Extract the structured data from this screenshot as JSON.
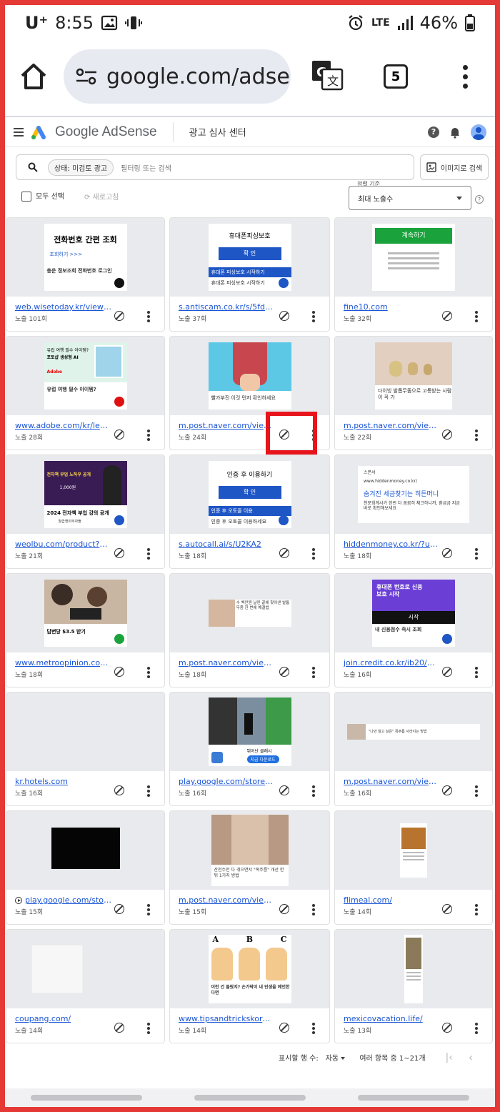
{
  "status": {
    "carrier": "U⁺",
    "time": "8:55",
    "network": "LTE",
    "battery": "46%"
  },
  "browser": {
    "url": "google.com/adse",
    "tab_count": "5"
  },
  "adsense": {
    "logo": "Google AdSense",
    "section": "광고 심사 센터"
  },
  "search": {
    "chip": "상태: 미검토 광고",
    "placeholder": "필터링 또는 검색",
    "image_search": "이미지로 검색"
  },
  "tools": {
    "select_all": "모두 선택",
    "refresh": "새로고침",
    "sort_label": "정렬 기준",
    "sort_value": "최대 노출수"
  },
  "ads": [
    {
      "url": "web.wisetoday.kr/view/a...",
      "impressions": "노출 101회"
    },
    {
      "url": "s.antiscam.co.kr/s/5fd0...",
      "impressions": "노출 37회"
    },
    {
      "url": "fine10.com",
      "impressions": "노출 32회"
    },
    {
      "url": "www.adobe.com/kr/lead...",
      "impressions": "노출 28회"
    },
    {
      "url": "m.post.naver.com/view...",
      "impressions": "노출 24회"
    },
    {
      "url": "m.post.naver.com/viewe...",
      "impressions": "노출 22회"
    },
    {
      "url": "weolbu.com/product?dis...",
      "impressions": "노출 21회"
    },
    {
      "url": "s.autocall.ai/s/U2KA2",
      "impressions": "노출 18회"
    },
    {
      "url": "hiddenmoney.co.kr/?utm...",
      "impressions": "노출 18회"
    },
    {
      "url": "www.metroopinion.com/...",
      "impressions": "노출 18회"
    },
    {
      "url": "m.post.naver.com/viewe...",
      "impressions": "노출 18회"
    },
    {
      "url": "join.credit.co.kr/ib20/mn...",
      "impressions": "노출 16회"
    },
    {
      "url": "kr.hotels.com",
      "impressions": "노출 16회"
    },
    {
      "url": "play.google.com/store/a...",
      "impressions": "노출 16회"
    },
    {
      "url": "m.post.naver.com/viewe...",
      "impressions": "노출 16회"
    },
    {
      "url": "play.google.com/stor...",
      "impressions": "노출 15회"
    },
    {
      "url": "m.post.naver.com/viewe...",
      "impressions": "노출 15회"
    },
    {
      "url": "flimeal.com/",
      "impressions": "노출 14회"
    },
    {
      "url": "coupang.com/",
      "impressions": "노출 14회"
    },
    {
      "url": "www.tipsandtrickskorea...",
      "impressions": "노출 14회"
    },
    {
      "url": "mexicovacation.life/",
      "impressions": "노출 13회"
    }
  ],
  "creatives": {
    "c1": {
      "title": "전화번호 간편 조회",
      "sub": "조회하기 >>>",
      "body": "총운 정보조회 전화번호 로그인"
    },
    "c2": {
      "title": "휴대폰피싱보호",
      "button": "확 인",
      "banner": "휴대폰 피싱보호 시작하기",
      "body": "휴대폰 피싱보호 시작하기"
    },
    "c3": {
      "button": "계속하기"
    },
    "c4": {
      "title": "유럽 여행 필수 아이템?",
      "sub": "포토샵 생성형 AI",
      "brand": "Adobe",
      "body": "유럽 여행 필수 아이템?"
    },
    "c5": {
      "body": "빨가부진 이것 먼저 확인하세요"
    },
    "c6": {
      "body": "다이빙 발톱무좀으로 고통받는 사람이 꼭 가"
    },
    "c7": {
      "tag": "전자책 부업 노하우 공개",
      "price": "1,000원",
      "title": "2024 전자책 부업 강의 공개",
      "brand": "월급쟁이부자들",
      "body": "재테크 부업 강의 공개"
    },
    "c8": {
      "title": "인증 후 이용하기",
      "button": "확 인",
      "banner": "인증 후 오토콜 이용",
      "body": "인증 후 오토콜 이용하세요"
    },
    "c9": {
      "tag": "스폰서",
      "url": "www.hiddenmoney.co.kr/",
      "title": "숨겨진 세금찾기는 히든머니",
      "body": "천문회계사가 한번 더 꼼꼼히 체크하니까, 환급금 지금 바로 확인해보세요"
    },
    "c10": {
      "title": "답변당 $3.5 받기"
    },
    "c11": {
      "body": "수 백만원 날린 끝에 찾아낸 발톱무좀 한 번에 해결법"
    },
    "c12": {
      "title": "휴대폰 번호로 신용 보호 시작",
      "button": "시작",
      "body": "내 신용점수 즉시 조회"
    },
    "c14": {
      "title": "뛰어난 클래시",
      "button": "지금 다운로드"
    },
    "c15": {
      "body": "\"나만 알고 싶은\" 목주름 사라지는 방법"
    },
    "c17": {
      "body": "산전수전 다 겪으면서 \"목주름\" 개선 한 뒤 1가지 방법"
    },
    "c20": {
      "letters": [
        "A",
        "B",
        "C"
      ],
      "body": "이런 건 몰랐지? 손가락이 내 인생을 예언한다면"
    }
  },
  "pager": {
    "rows_label": "표시할 행 수:",
    "rows_value": "자동",
    "range": "여러 항목 중 1~21개"
  }
}
